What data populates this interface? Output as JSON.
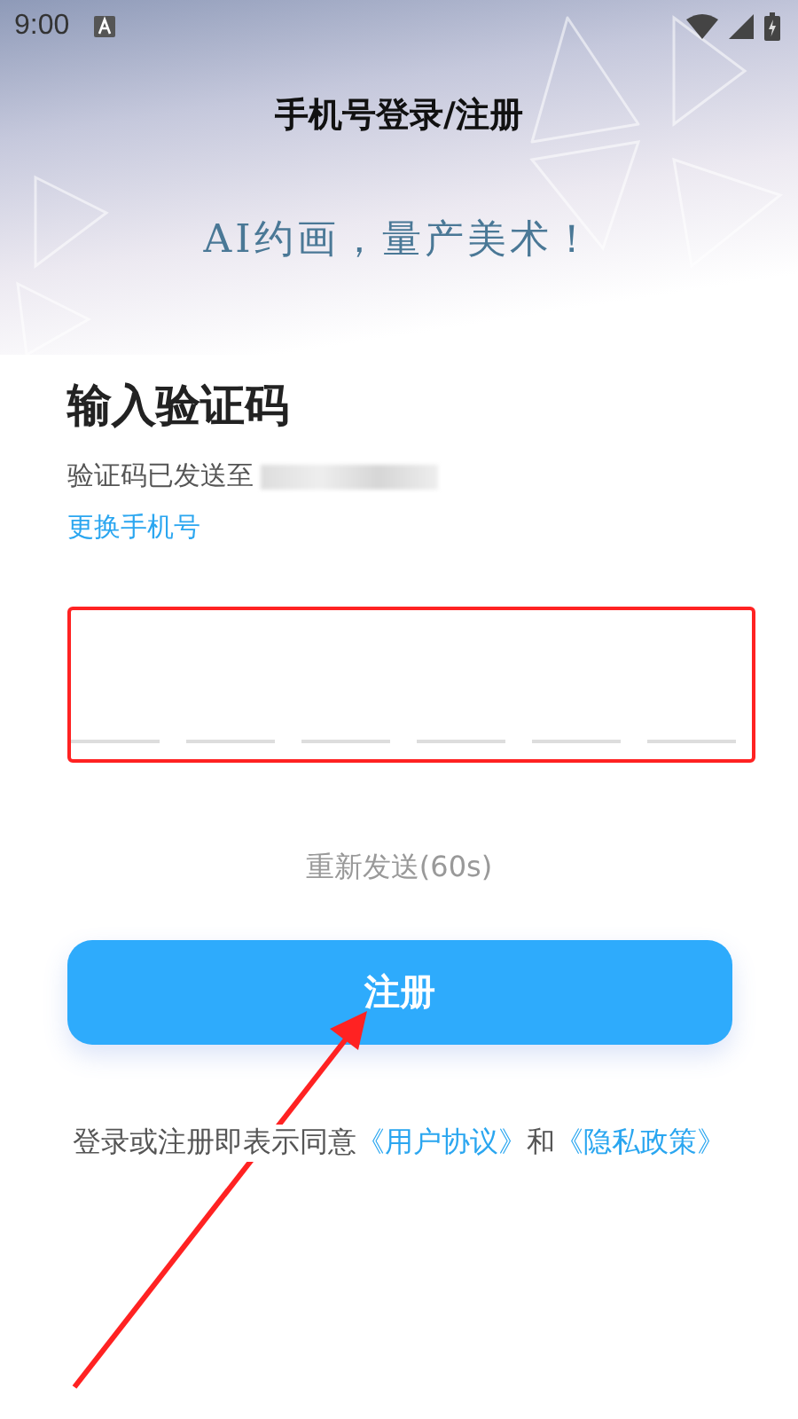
{
  "status_bar": {
    "time": "9:00"
  },
  "header": {
    "title": "手机号登录/注册",
    "slogan": "AI约画，量产美术！"
  },
  "verify": {
    "heading": "输入验证码",
    "sent_to": "验证码已发送至",
    "change_link": "更换手机号",
    "code_slots": [
      {
        "filled": false
      },
      {
        "filled": false
      },
      {
        "filled": false
      },
      {
        "filled": false
      },
      {
        "filled": false
      },
      {
        "filled": false
      }
    ],
    "resend": "重新发送(60s)",
    "submit": "注册"
  },
  "agreement": {
    "text": "登录或注册即表示同意",
    "link_1": "《用户协议》",
    "and": "和",
    "link_2": "《隐私政策》"
  }
}
